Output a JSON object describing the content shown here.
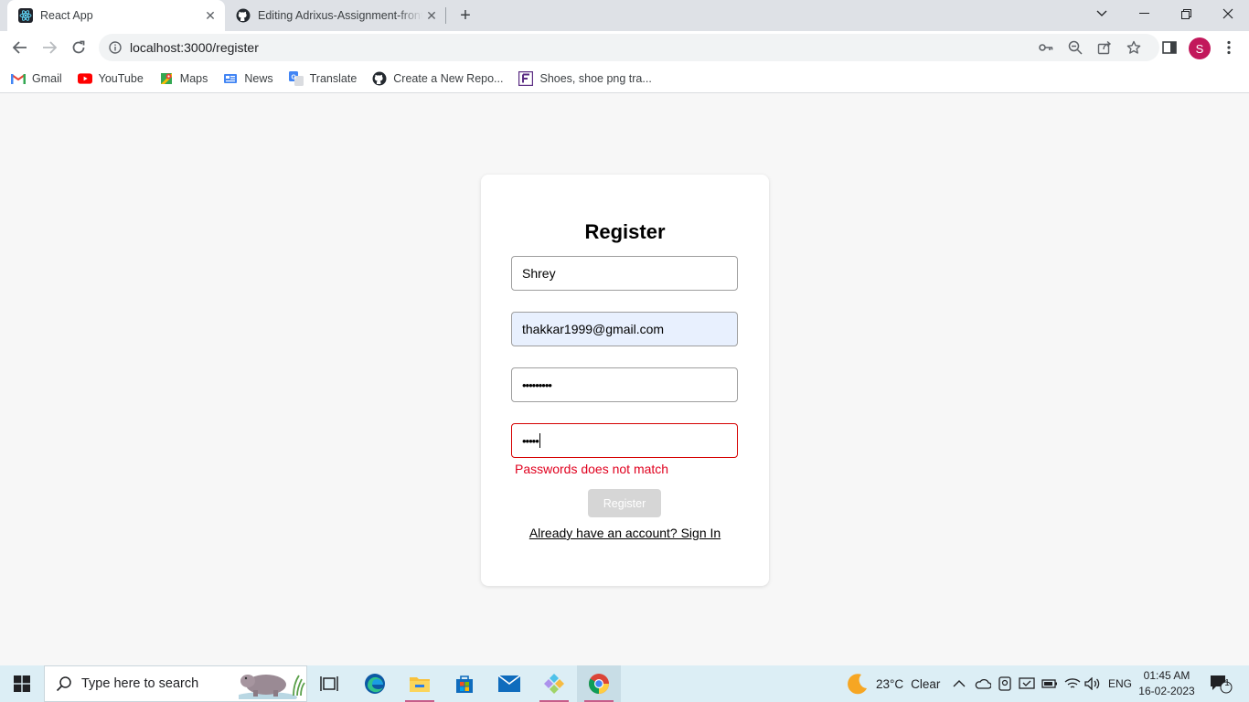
{
  "browser": {
    "tabs": [
      {
        "title": "React App",
        "icon": "react-icon"
      },
      {
        "title": "Editing Adrixus-Assignment-front",
        "icon": "github-icon"
      }
    ],
    "url": "localhost:3000/register",
    "profile_initial": "S",
    "bookmarks": [
      {
        "label": "Gmail",
        "icon": "gmail-icon"
      },
      {
        "label": "YouTube",
        "icon": "youtube-icon"
      },
      {
        "label": "Maps",
        "icon": "maps-icon"
      },
      {
        "label": "News",
        "icon": "news-icon"
      },
      {
        "label": "Translate",
        "icon": "translate-icon"
      },
      {
        "label": "Create a New Repo...",
        "icon": "github-icon"
      },
      {
        "label": "Shoes, shoe png tra...",
        "icon": "bookmark-f-icon"
      }
    ]
  },
  "form": {
    "title": "Register",
    "name_value": "Shrey",
    "email_value": "thakkar1999@gmail.com",
    "password_value": "•••••••••",
    "confirm_value": "•••••",
    "error_message": "Passwords does not match",
    "submit_label": "Register",
    "signin_link": "Already have an account? Sign In"
  },
  "taskbar": {
    "search_placeholder": "Type here to search",
    "weather_temp": "23°C",
    "weather_text": "Clear",
    "language": "ENG",
    "time": "01:45 AM",
    "date": "16-02-2023",
    "notification_count": "1"
  },
  "colors": {
    "error": "#e0001e",
    "autofill_bg": "#e8f0fe",
    "taskbar_bg": "#dceef5",
    "avatar": "#c2185b"
  }
}
